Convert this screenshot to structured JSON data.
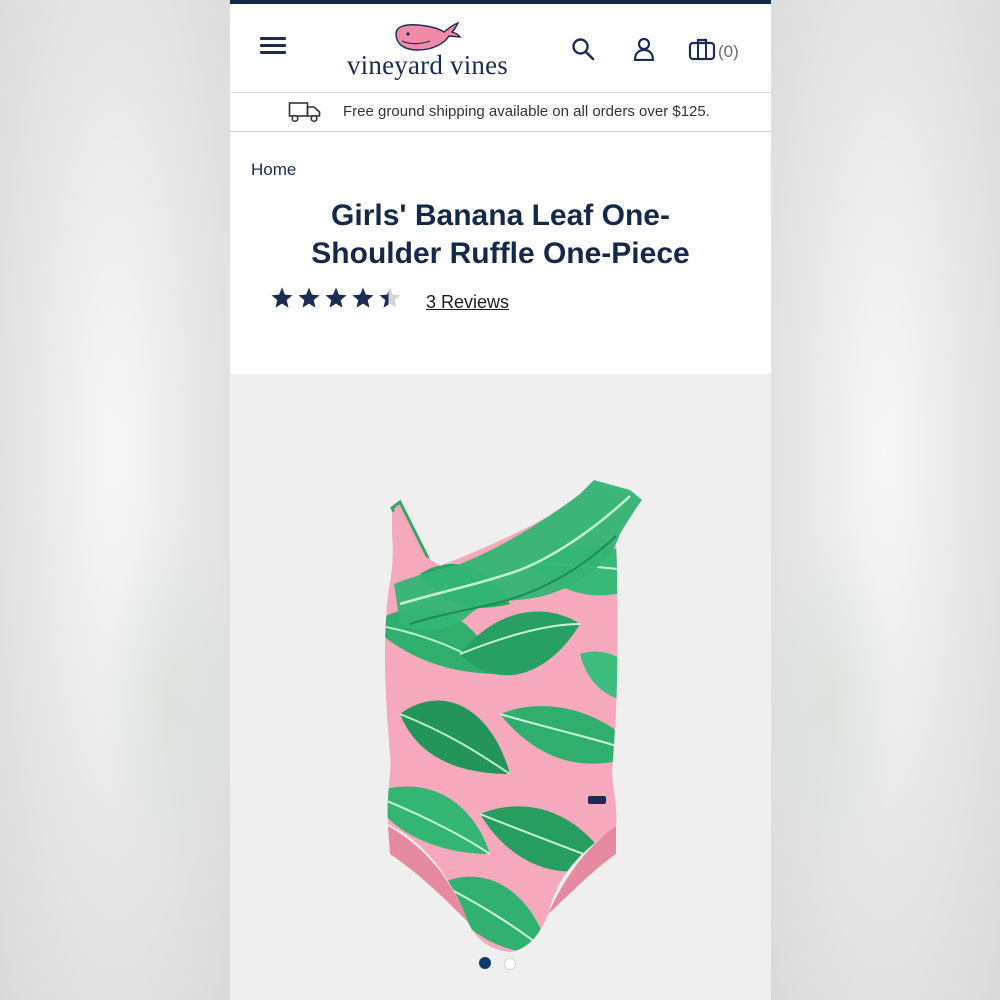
{
  "header": {
    "brand_name": "vineyard vines",
    "cart_count": "(0)",
    "icons": [
      "menu-icon",
      "whale-logo-icon",
      "search-icon",
      "account-icon",
      "shopping-bag-icon"
    ]
  },
  "shipping_banner": {
    "text": "Free ground shipping available on all orders over $125.",
    "icon": "delivery-truck-icon"
  },
  "breadcrumb": {
    "home_label": "Home"
  },
  "product": {
    "title": "Girls' Banana Leaf One-Shoulder Ruffle One-Piece",
    "rating": 4.4,
    "rating_max": 5,
    "reviews_label": "3 Reviews"
  },
  "gallery": {
    "image_count": 2,
    "active_index": 0
  },
  "colors": {
    "navy": "#16284a",
    "whale_pink": "#f08aa6",
    "star_filled": "#1b2c54",
    "star_empty": "#d4d4d4",
    "dot_active": "#0f3a6e",
    "gallery_bg": "#efefef"
  }
}
